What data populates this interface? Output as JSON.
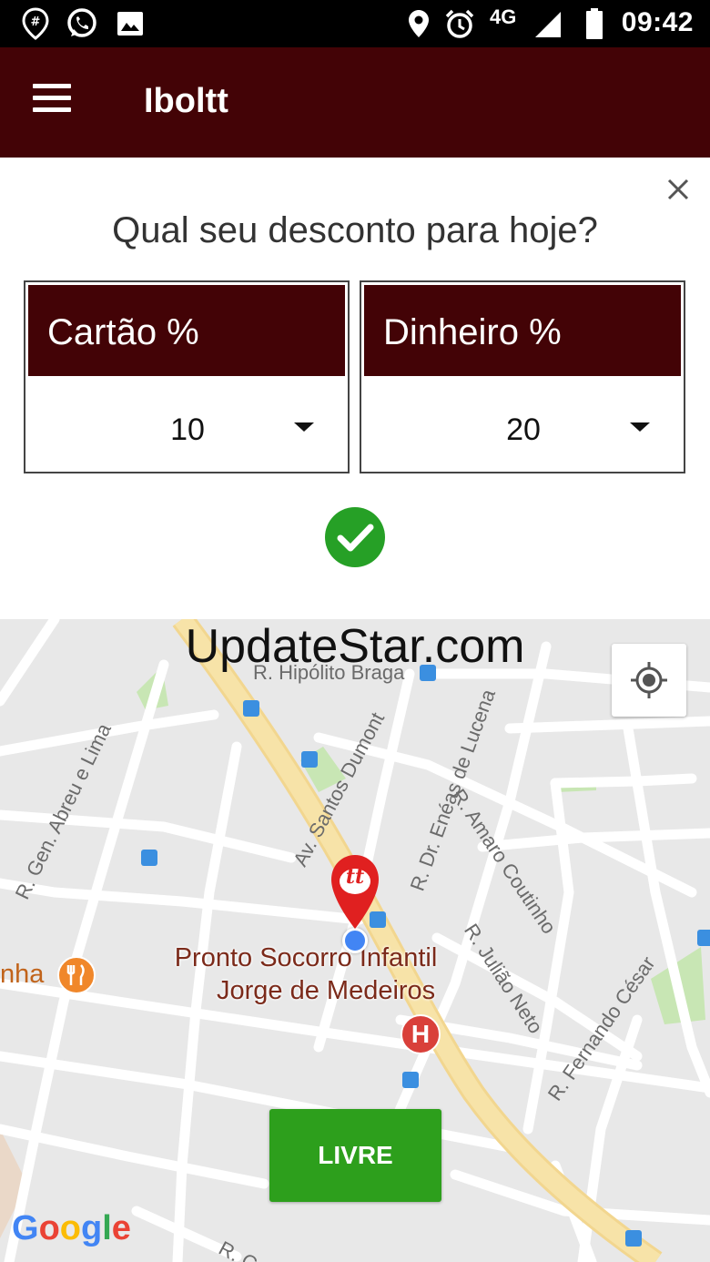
{
  "status_bar": {
    "network": "4G",
    "time": "09:42",
    "icons": [
      "location-hash-icon",
      "whatsapp-icon",
      "gallery-icon",
      "location-icon",
      "alarm-icon",
      "signal-icon",
      "battery-icon"
    ]
  },
  "app_bar": {
    "title": "Iboltt",
    "menu_icon": "hamburger-icon",
    "background": "#430306"
  },
  "dialog": {
    "question": "Qual seu desconto para hoje?",
    "card": {
      "label": "Cartão %",
      "value": "10"
    },
    "cash": {
      "label": "Dinheiro %",
      "value": "20"
    },
    "confirm_icon": "check-circle-icon",
    "close_icon": "close-icon"
  },
  "map": {
    "watermark": "UpdateStar.com",
    "streets": {
      "hipolito": "R. Hipólito Braga",
      "abreu": "R. Gen. Abreu e Lima",
      "santos": "Av. Santos Dumont",
      "eneas": "R. Dr. Enéas de Lucena",
      "amaro": "R. Amaro Coutinho",
      "juliao": "R. Julião Neto",
      "fernando": "R. Fernando César",
      "bottom": "R. Ca"
    },
    "poi": {
      "line1": "Pronto Socorro Infantil",
      "line2": "Jorge de Medeiros"
    },
    "restaurant_partial": "nha",
    "pin_label": "tt",
    "hospital_label": "H",
    "status_button": "LIVRE",
    "google_logo": {
      "letters": [
        "G",
        "o",
        "o",
        "g",
        "l",
        "e"
      ],
      "colors": [
        "#4285F4",
        "#EA4335",
        "#FBBC05",
        "#4285F4",
        "#34A853",
        "#EA4335"
      ]
    },
    "accent_green": "#2d9f1c",
    "pin_red": "#e02020"
  }
}
